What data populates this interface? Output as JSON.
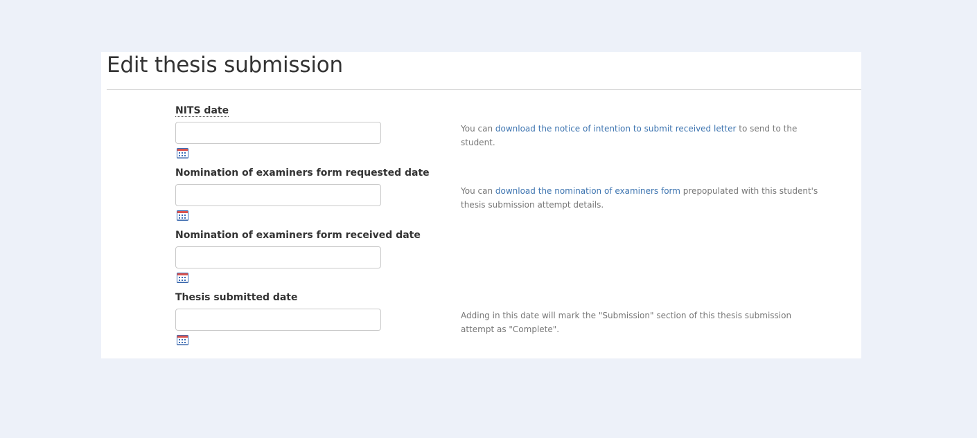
{
  "page": {
    "title": "Edit thesis submission"
  },
  "fields": [
    {
      "label": "NITS date",
      "value": "",
      "placeholder": "",
      "calendar_icon": "calendar-icon",
      "help": {
        "before": "You can ",
        "link": "download the notice of intention to submit received letter",
        "after": " to send to the student."
      }
    },
    {
      "label": "Nomination of examiners form requested date",
      "value": "",
      "placeholder": "",
      "calendar_icon": "calendar-icon",
      "help": {
        "before": "You can ",
        "link": "download the nomination of examiners form",
        "after": " prepopulated with this student's thesis submission attempt details."
      }
    },
    {
      "label": "Nomination of examiners form received date",
      "value": "",
      "placeholder": "",
      "calendar_icon": "calendar-icon"
    },
    {
      "label": "Thesis submitted date",
      "value": "",
      "placeholder": "",
      "calendar_icon": "calendar-icon",
      "help": {
        "text": "Adding in this date will mark the \"Submission\" section of this thesis submission attempt as \"Complete\"."
      }
    }
  ],
  "colors": {
    "background": "#edf1f9",
    "panel": "#ffffff",
    "link": "#3d74b0",
    "help_text": "#777777"
  }
}
